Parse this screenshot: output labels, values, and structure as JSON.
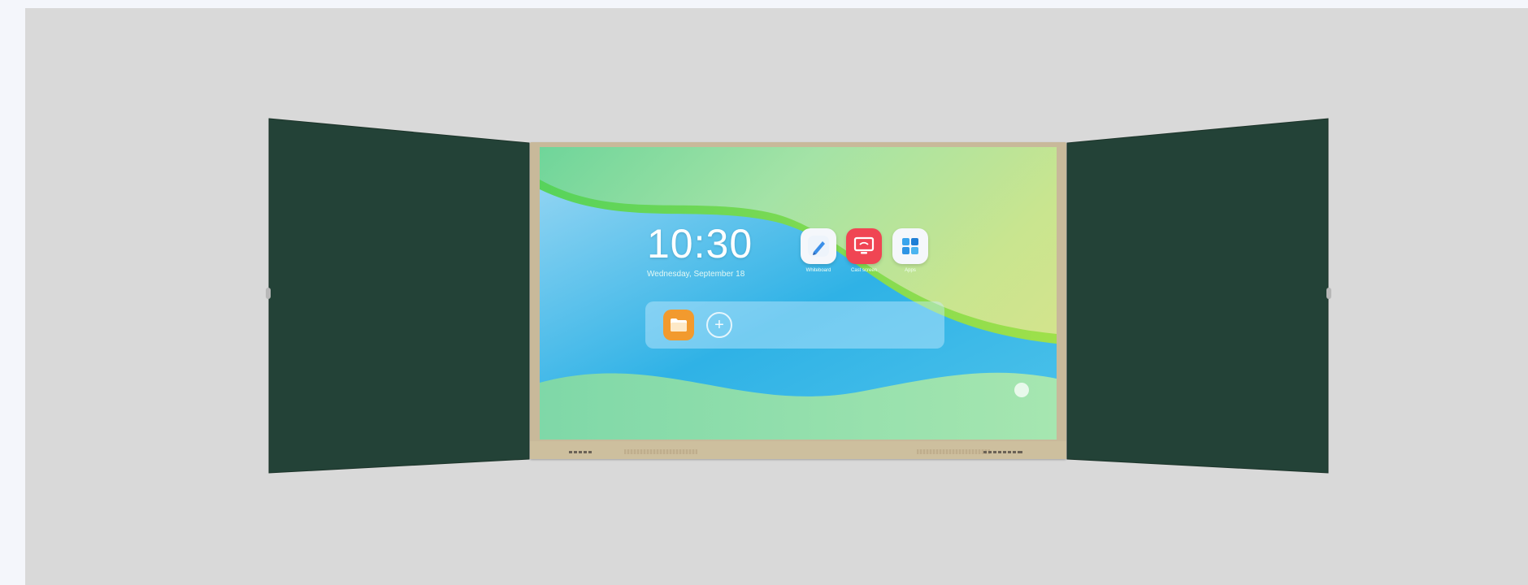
{
  "colors": {
    "background": "#d9d9d9",
    "chalkboard": "#234237",
    "frame": "#c8b99a"
  },
  "screen": {
    "time": "10:30",
    "date": "Wednesday, September 18",
    "apps": [
      {
        "label": "Whiteboard",
        "icon": "pen-icon",
        "color": "#f5f7fb"
      },
      {
        "label": "Cast screen",
        "icon": "screen-cast-icon",
        "color": "#f04553"
      },
      {
        "label": "Apps",
        "icon": "app-grid-icon",
        "color": "#f5f7fb"
      }
    ],
    "dock": {
      "items": [
        {
          "icon": "folder-icon",
          "color": "#f29a2e"
        }
      ],
      "add_label": "+"
    }
  }
}
